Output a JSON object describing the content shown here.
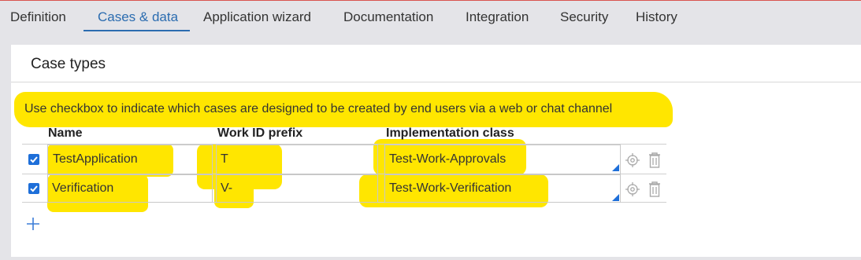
{
  "tabs": [
    {
      "label": "Definition"
    },
    {
      "label": "Cases & data"
    },
    {
      "label": "Application wizard"
    },
    {
      "label": "Documentation"
    },
    {
      "label": "Integration"
    },
    {
      "label": "Security"
    },
    {
      "label": "History"
    }
  ],
  "active_tab": "Cases & data",
  "panel": {
    "title": "Case types",
    "hint": "Use checkbox to indicate which cases are designed to be created by end users via a web or chat channel"
  },
  "table": {
    "headers": {
      "name": "Name",
      "prefix": "Work ID prefix",
      "impl": "Implementation class"
    },
    "rows": [
      {
        "checked": true,
        "name": "TestApplication",
        "prefix": "T",
        "impl": "Test-Work-Approvals"
      },
      {
        "checked": true,
        "name": "Verification",
        "prefix": "V-",
        "impl": "Test-Work-Verification"
      }
    ]
  },
  "icons": {
    "row_target": "crosshair-icon",
    "row_delete": "trash-icon",
    "add": "plus-icon"
  },
  "colors": {
    "accent": "#2b6cb0",
    "highlight": "#ffe600",
    "checkbox": "#1e6fd9"
  }
}
